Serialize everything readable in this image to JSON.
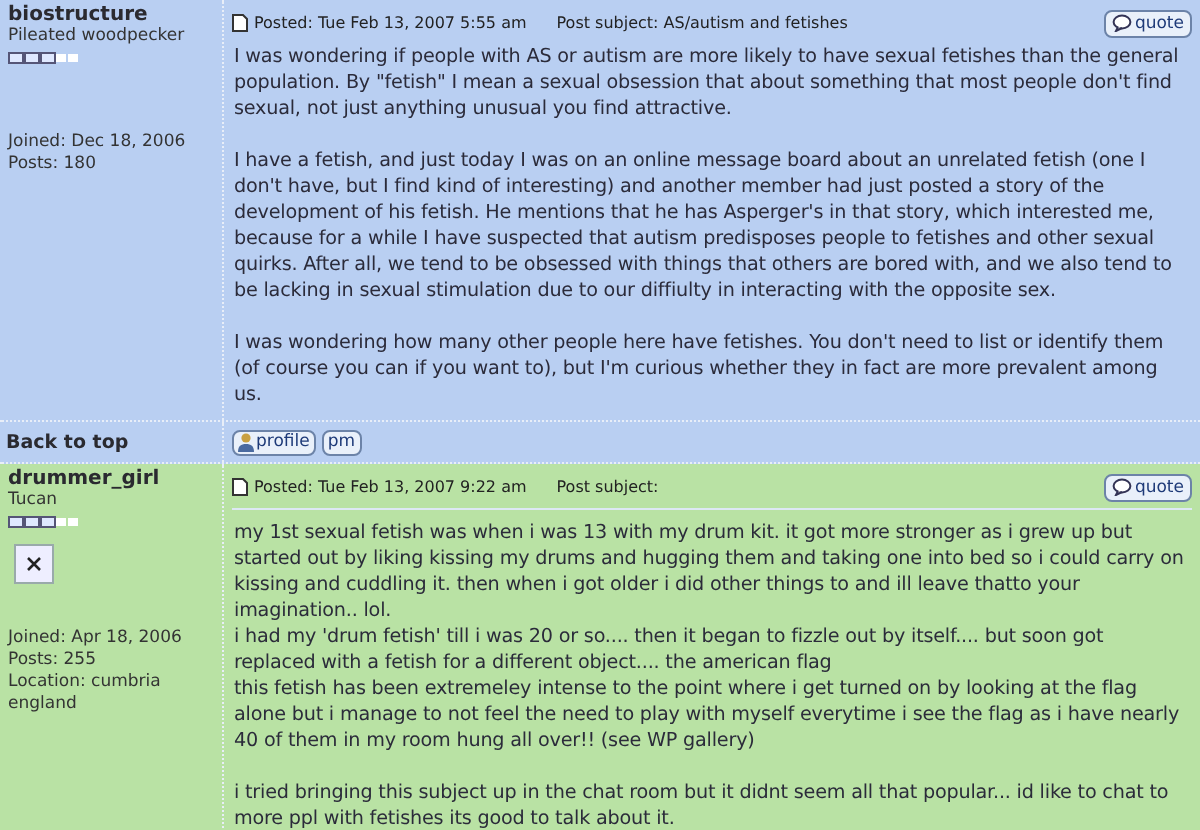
{
  "posts": [
    {
      "color": "#b9cff2",
      "author": "biostructure",
      "rank": "Pileated woodpecker",
      "profile_lines": [
        "Joined: Dec 18, 2006",
        "Posts: 180"
      ],
      "posted": "Posted: Tue Feb 13, 2007 5:55 am",
      "subject": "Post subject: AS/autism and fetishes",
      "quote": "quote",
      "divider": false,
      "blocks": [
        [
          "I was wondering if people with AS or autism are more likely to have sexual fetishes than the general population. By \"fetish\" I mean a sexual obsession that about something that most people don't find sexual, not just anything unusual you find attractive."
        ],
        [
          "I have a fetish, and just today I was on an online message board about an unrelated fetish (one I don't have, but I find kind of interesting) and another member had just posted a story of the development of his fetish. He mentions that he has Asperger's in that story, which interested me, because for a while I have suspected that autism predisposes people to fetishes and other sexual quirks. After all, we tend to be obsessed with things that others are bored with, and we also tend to be lacking in sexual stimulation due to our diffiulty in interacting with the opposite sex."
        ],
        [
          "I was wondering how many other people here have fetishes. You don't need to list or identify them (of course you can if you want to), but I'm curious whether they in fact are more prevalent among us."
        ]
      ],
      "footer": {
        "back_to_top": "Back to top",
        "buttons": [
          "profile",
          "pm"
        ]
      }
    },
    {
      "color": "#b9e2a4",
      "author": "drummer_girl",
      "rank": "Tucan",
      "avatar": true,
      "profile_lines": [
        "Joined: Apr 18, 2006",
        "Posts: 255",
        "Location: cumbria england"
      ],
      "posted": "Posted: Tue Feb 13, 2007 9:22 am",
      "subject": "Post subject:",
      "quote": "quote",
      "divider": true,
      "blocks": [
        [
          "my 1st sexual fetish was when i was 13 with my drum kit. it got more stronger as i grew up but started out by liking kissing my drums and hugging them and taking one into bed so i could carry on kissing and cuddling it. then when i got older i did other things to and ill leave thatto your imagination.. lol.",
          "i had my 'drum fetish' till i was 20 or so.... then it began to fizzle out by itself.... but soon got replaced with a fetish for a different object.... the american flag",
          "this fetish has been extremeley intense to the point where i get turned on by looking at the flag alone but i manage to not feel the need to play with myself everytime i see the flag as i have nearly 40 of them in my room hung all over!! (see WP gallery)"
        ],
        [
          "i tried bringing this subject up in the chat room but it didnt seem all that popular... id like to chat to more ppl with fetishes its good to talk about it."
        ]
      ]
    }
  ]
}
